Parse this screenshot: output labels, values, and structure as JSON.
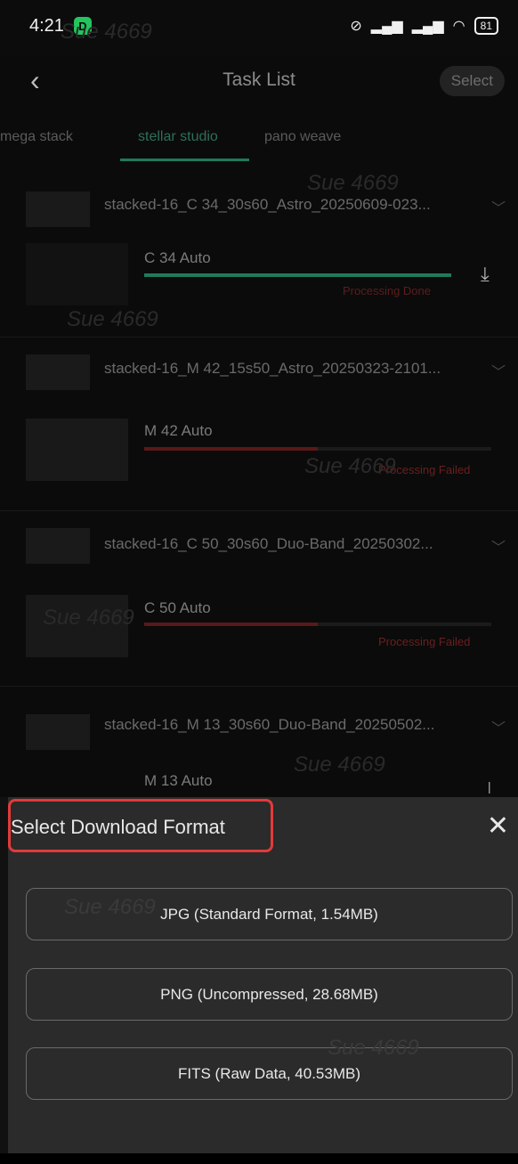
{
  "status_bar": {
    "time": "4:21",
    "app_badge": "D",
    "signal": "HD",
    "battery": "81"
  },
  "header": {
    "back_icon": "chevron-left-icon",
    "title": "Task List",
    "select_label": "Select"
  },
  "tabs": [
    "mega stack",
    "stellar studio",
    "pano weave"
  ],
  "active_tab": "stellar studio",
  "watermark_text": "Sue 4669",
  "tasks": [
    {
      "title": "stacked-16_C 34_30s60_Astro_20250609-023...",
      "label": "C 34 Auto",
      "progress": 1.0,
      "status": "Processing Done",
      "status_color": "#6a1a1a"
    },
    {
      "title": "stacked-16_M 42_15s50_Astro_20250323-2101...",
      "label": "M 42 Auto",
      "progress": 0.5,
      "status": "Processing Failed",
      "status_color": "#7a1e1e"
    },
    {
      "title": "stacked-16_C 50_30s60_Duo-Band_20250302...",
      "label": "C 50 Auto",
      "progress": 0.5,
      "status": "Processing Failed",
      "status_color": "#7a1e1e"
    },
    {
      "title": "stacked-16_M 13_30s60_Duo-Band_20250502...",
      "label": "M 13 Auto"
    }
  ],
  "sheet": {
    "title": "Select Download Format",
    "options": [
      "JPG (Standard Format, 1.54MB)",
      "PNG (Uncompressed, 28.68MB)",
      "FITS (Raw Data, 40.53MB)"
    ]
  },
  "colors": {
    "accent": "#1f7a5c",
    "failed": "#7a1e1e",
    "highlight": "#e23a3a"
  }
}
